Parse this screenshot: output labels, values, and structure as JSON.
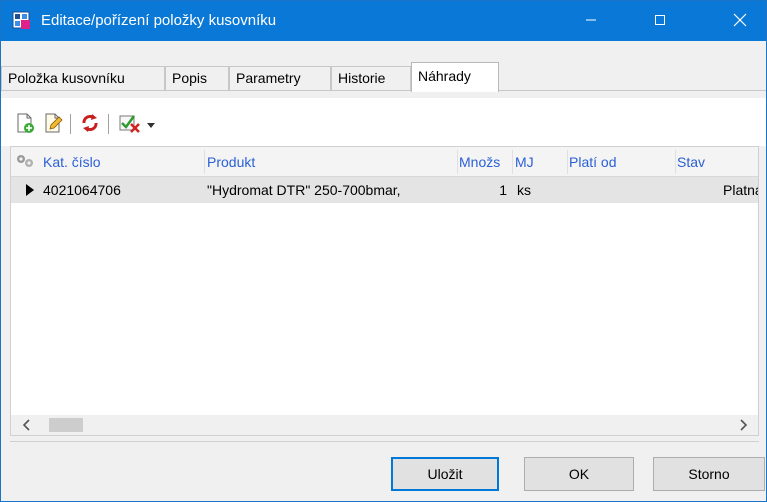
{
  "window": {
    "title": "Editace/pořízení položky kusovníku"
  },
  "tabs": [
    {
      "label": "Položka kusovníku"
    },
    {
      "label": "Popis"
    },
    {
      "label": "Parametry"
    },
    {
      "label": "Historie"
    },
    {
      "label": "Náhrady"
    }
  ],
  "active_tab": "Náhrady",
  "toolbar": {
    "icons": [
      "new-record-icon",
      "edit-record-icon",
      "refresh-icon",
      "actions-icon",
      "dropdown-arrow-icon"
    ]
  },
  "grid": {
    "columns": [
      {
        "label": "Kat. číslo"
      },
      {
        "label": "Produkt"
      },
      {
        "label": "Množs"
      },
      {
        "label": "MJ"
      },
      {
        "label": "Platí od"
      },
      {
        "label": "Stav"
      }
    ],
    "rows": [
      {
        "kat_cislo": "4021064706",
        "produkt": "\"Hydromat DTR\" 250-700bmar,",
        "mnozstvi": "1",
        "mj": "ks",
        "plati_od": "",
        "stav": "Platná"
      }
    ]
  },
  "buttons": {
    "save": "Uložit",
    "ok": "OK",
    "cancel": "Storno"
  },
  "colors": {
    "titlebar": "#0a78d6",
    "header_text": "#2a5fd6",
    "selected_row": "#e4e4e4"
  }
}
